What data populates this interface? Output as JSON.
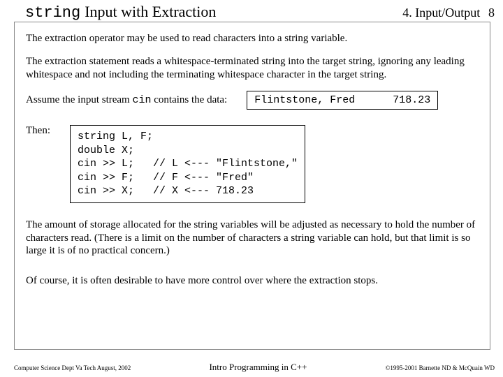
{
  "header": {
    "title_mono": "string",
    "title_rest": "Input with Extraction",
    "section": "4. Input/Output",
    "page_num": "8"
  },
  "body": {
    "para1": "The extraction operator may be used to read characters into a string variable.",
    "para2": "The extraction statement reads a whitespace-terminated string into the target string, ignoring any leading whitespace and not including the terminating whitespace character in the target string.",
    "assume_prefix": "Assume the input stream ",
    "assume_mono": "cin",
    "assume_suffix": " contains the data:",
    "data_left": "Flintstone, Fred",
    "data_right": "718.23",
    "then_label": "Then:",
    "code": "string L, F;\ndouble X;\ncin >> L;   // L <--- \"Flintstone,\"\ncin >> F;   // F <--- \"Fred\"\ncin >> X;   // X <--- 718.23",
    "para3": "The amount of storage allocated for the string variables will be adjusted as necessary to hold the number of characters read.  (There is a limit on the number of characters a string variable can hold, but that limit is so large it is of no practical concern.)",
    "para4": "Of course, it is often desirable to have more control over where the extraction stops."
  },
  "footer": {
    "left": "Computer Science Dept Va Tech  August, 2002",
    "center": "Intro Programming in C++",
    "right": "©1995-2001 Barnette ND & McQuain WD"
  }
}
